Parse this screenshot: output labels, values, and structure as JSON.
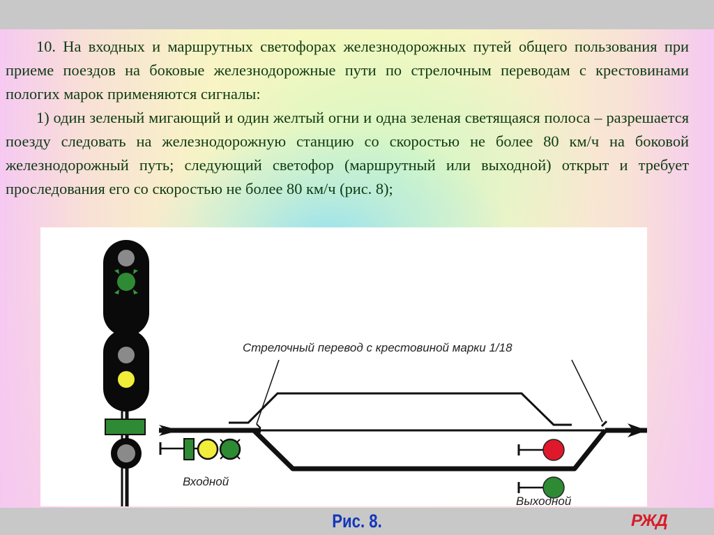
{
  "slide": {
    "paragraphs": [
      {
        "lines": [
          "10. На входных и маршрутных светофорах железнодорожных путей общего",
          "пользования при приеме поездов на боковые железнодорожные пути по",
          "стрелочным переводам с крестовинами пологих марок применяются сигналы:"
        ]
      },
      {
        "lines": [
          "1) один зеленый мигающий и один желтый огни и одна зеленая светящаяся",
          "полоса – разрешается поезду следовать на железнодорожную станцию со",
          "скоростью не более 80 км/ч на боковой железнодорожный путь; следующий",
          "светофор (маршрутный или выходной) открыт и требует проследования его со",
          "скоростью не более 80 км/ч (рис. 8);"
        ]
      }
    ],
    "figure": {
      "switch_label": "Стрелочный перевод с крестовиной марки 1/18",
      "entry_signal_label": "Входной",
      "exit_signal_label": "Выходной",
      "mast_signal": {
        "upper_head": [
          "gray",
          "green-flashing"
        ],
        "lower_head": [
          "gray",
          "yellow"
        ],
        "strip": "green",
        "bottom_lamp": "gray"
      },
      "entry_signal_aspects": [
        "green-strip",
        "yellow",
        "green-flashing"
      ],
      "exit_signal_upper": "red",
      "exit_signal_lower": "green"
    },
    "caption": "Рис. 8.",
    "logo_text": "РЖД"
  },
  "colors": {
    "text": "#0e3a12",
    "caption": "#1437b8",
    "logo": "#d81c2a",
    "signal_green": "#2e8b34",
    "signal_yellow": "#f2ec3a",
    "signal_red": "#e0182c",
    "signal_gray": "#8a8a8a",
    "bar_gray": "#c8c8c8"
  }
}
